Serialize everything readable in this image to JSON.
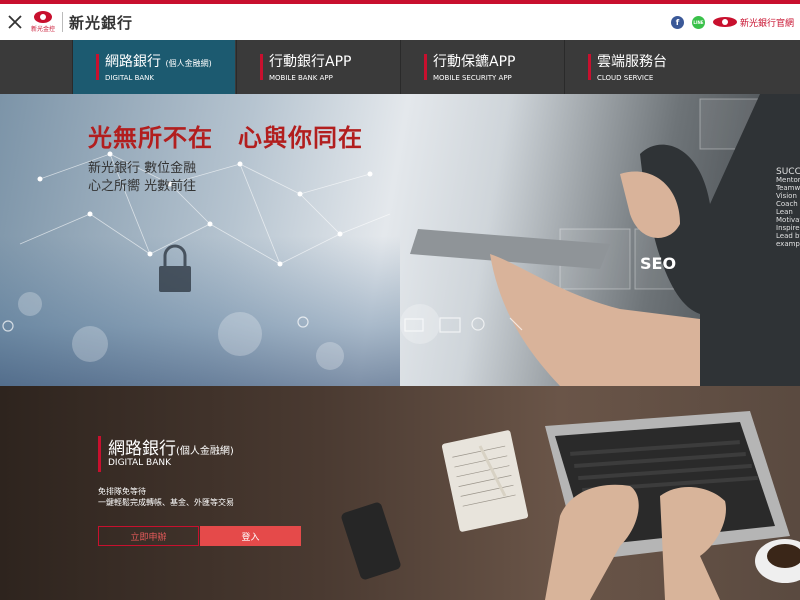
{
  "header": {
    "logo_small": "新光金控",
    "logo_name": "新光銀行",
    "official_label": "新光銀行官網",
    "facebook_icon": "f",
    "line_icon": "LINE"
  },
  "nav": {
    "items": [
      {
        "title": "網路銀行",
        "title_small": "(個人金融網)",
        "subtitle": "DIGITAL BANK",
        "active": true
      },
      {
        "title": "行動銀行APP",
        "title_small": "",
        "subtitle": "MOBILE BANK APP",
        "active": false
      },
      {
        "title": "行動保鑣APP",
        "title_small": "",
        "subtitle": "MOBILE SECURITY APP",
        "active": false
      },
      {
        "title": "雲端服務台",
        "title_small": "",
        "subtitle": "CLOUD SERVICE",
        "active": false
      }
    ]
  },
  "hero": {
    "title": "光無所不在　心與你同在",
    "subtitle_line1": "新光銀行 數位金融",
    "subtitle_line2": "心之所嚮 光數前往",
    "tile_seo": "SEO",
    "tile_text": [
      "SUCC",
      "Mentor",
      "Teamwo",
      "Vision",
      "Coach",
      "Lean",
      "Motivate",
      "Inspire",
      "Lead by",
      "example"
    ]
  },
  "promo": {
    "title": "網路銀行",
    "title_small": "(個人金融網)",
    "subtitle": "DIGITAL BANK",
    "desc_line1": "免排隊免等待",
    "desc_line2": "一鍵輕鬆完成轉帳、基金、外匯等交易",
    "apply_label": "立即申辦",
    "login_label": "登入"
  },
  "colors": {
    "accent": "#c8102e",
    "nav_bg": "#3a3a3a",
    "nav_active": "#1c5a70",
    "login_btn": "#e54a4a"
  }
}
